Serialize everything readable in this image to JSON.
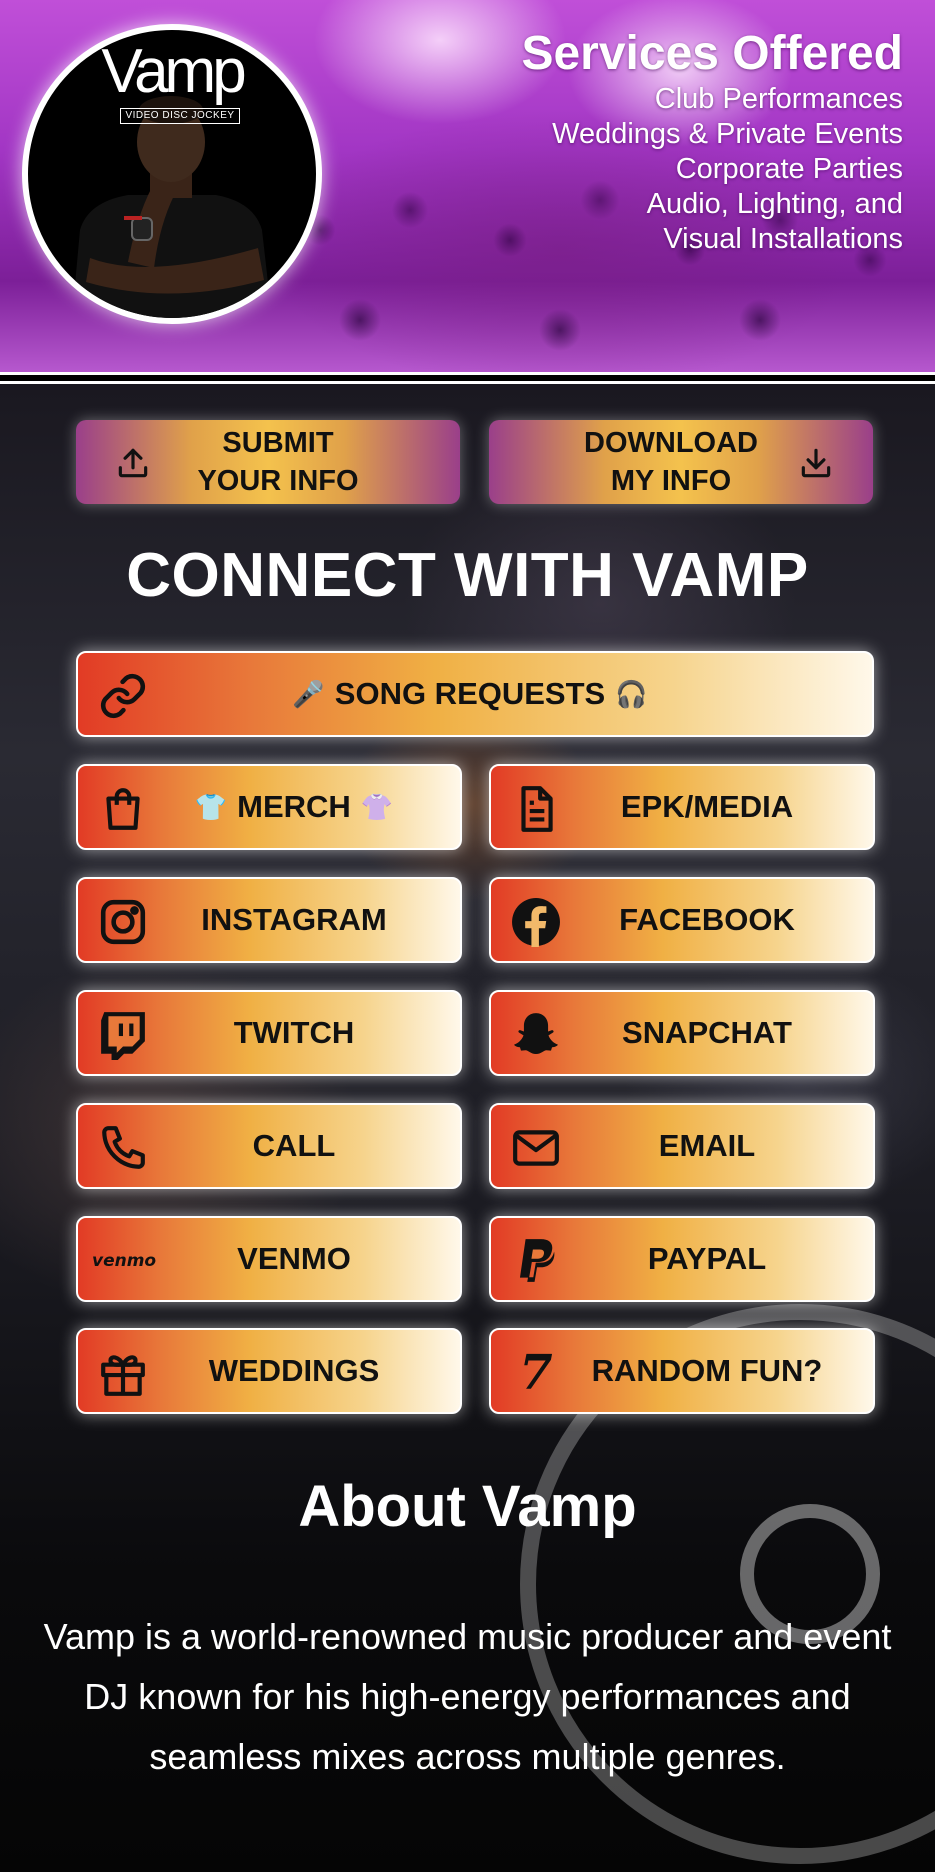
{
  "logo": {
    "wordmark": "Vamp",
    "tagline": "VIDEO DISC JOCKEY"
  },
  "services": {
    "title": "Services Offered",
    "items": [
      "Club Performances",
      "Weddings & Private Events",
      "Corporate Parties",
      "Audio, Lighting, and",
      "Visual Installations"
    ]
  },
  "actions": {
    "submit": {
      "line1": "SUBMIT",
      "line2": "YOUR INFO",
      "icon": "upload-icon"
    },
    "download": {
      "line1": "DOWNLOAD",
      "line2": "MY INFO",
      "icon": "download-icon"
    }
  },
  "connect_title": "CONNECT WITH VAMP",
  "links": {
    "song_requests": {
      "label": "SONG REQUESTS",
      "emoji_left": "🎤",
      "emoji_right": "🎧",
      "icon": "link-icon"
    },
    "merch": {
      "label": "MERCH",
      "emoji_left": "👕",
      "emoji_right": "👚",
      "icon": "shopping-bag-icon"
    },
    "epk": {
      "label": "EPK/MEDIA",
      "icon": "document-icon"
    },
    "instagram": {
      "label": "INSTAGRAM",
      "icon": "instagram-icon"
    },
    "facebook": {
      "label": "FACEBOOK",
      "icon": "facebook-icon"
    },
    "twitch": {
      "label": "TWITCH",
      "icon": "twitch-icon"
    },
    "snapchat": {
      "label": "SNAPCHAT",
      "icon": "snapchat-icon"
    },
    "call": {
      "label": "CALL",
      "icon": "phone-icon"
    },
    "email": {
      "label": "EMAIL",
      "icon": "mail-icon"
    },
    "venmo": {
      "label": "VENMO",
      "icon_text": "venmo",
      "icon": "venmo-icon"
    },
    "paypal": {
      "label": "PAYPAL",
      "icon": "paypal-icon"
    },
    "weddings": {
      "label": "WEDDINGS",
      "icon": "gift-icon"
    },
    "random": {
      "label": "RANDOM FUN?",
      "icon_text": "7",
      "icon": "seven-icon"
    }
  },
  "about": {
    "title": "About Vamp",
    "text": "Vamp is a world-renowned music producer and event DJ known for his high-energy performances and seamless mixes across multiple genres."
  },
  "colors": {
    "header_purple": "#a236c4",
    "button_red": "#e23b25",
    "button_gold": "#f0b044",
    "button_cream": "#fff8ea"
  }
}
